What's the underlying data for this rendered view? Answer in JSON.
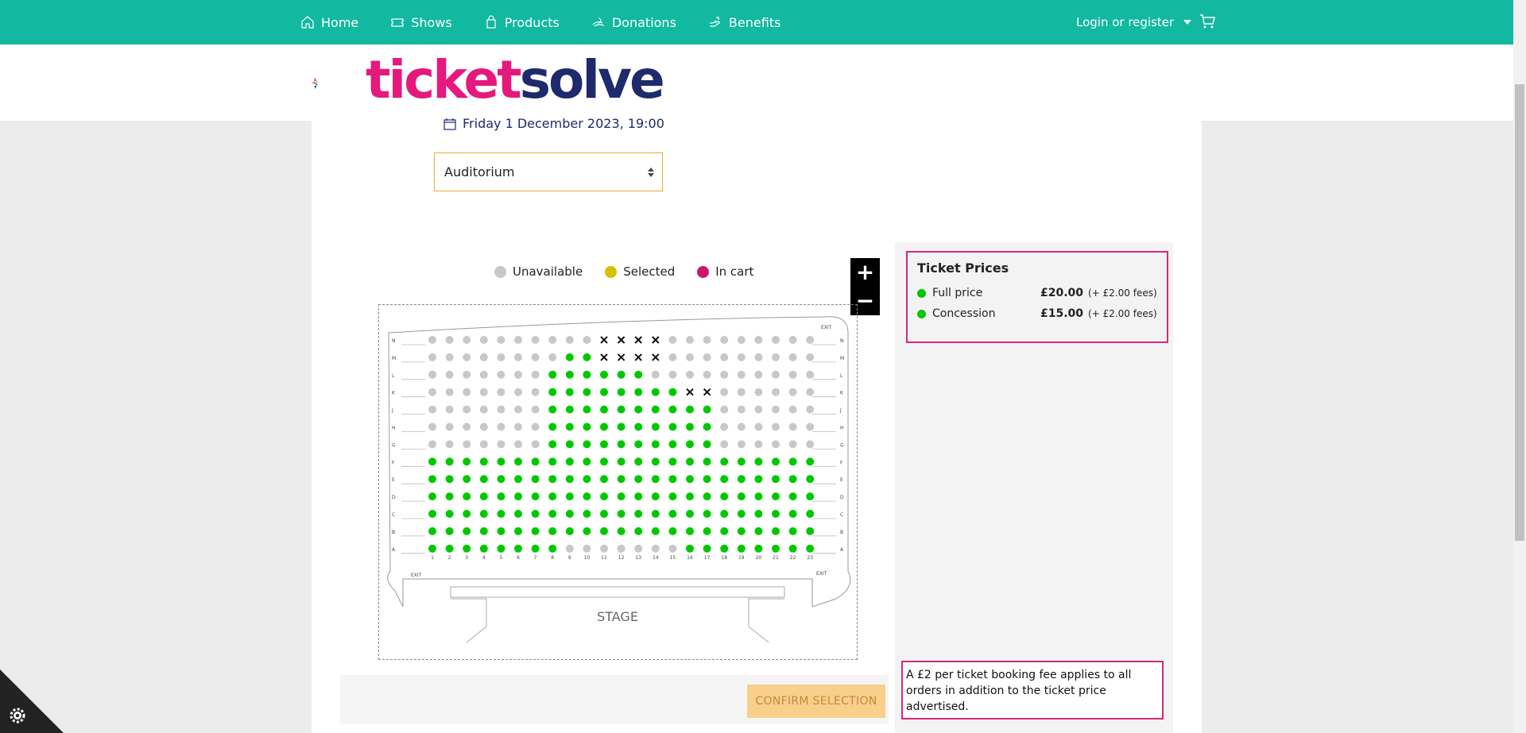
{
  "nav": {
    "items": [
      {
        "label": "Home",
        "icon": "home-icon"
      },
      {
        "label": "Shows",
        "icon": "ticket-icon"
      },
      {
        "label": "Products",
        "icon": "bag-icon"
      },
      {
        "label": "Donations",
        "icon": "donate-icon"
      },
      {
        "label": "Benefits",
        "icon": "hand-icon"
      }
    ],
    "login_label": "Login or register"
  },
  "logo": {
    "part1": "ticket",
    "part2": "solve"
  },
  "event": {
    "datetime": "Friday 1 December 2023, 19:00"
  },
  "venue_select": {
    "value": "Auditorium"
  },
  "legend": {
    "unavailable": "Unavailable",
    "selected": "Selected",
    "in_cart": "In cart"
  },
  "zoom": {
    "in": "+",
    "out": "−"
  },
  "seatmap": {
    "rows": [
      "N",
      "M",
      "L",
      "K",
      "J",
      "H",
      "G",
      "F",
      "E",
      "D",
      "C",
      "B",
      "A"
    ],
    "columns": [
      "1",
      "2",
      "3",
      "4",
      "5",
      "6",
      "7",
      "8",
      "9",
      "10",
      "11",
      "12",
      "13",
      "14",
      "15",
      "16",
      "17",
      "18",
      "19",
      "20",
      "21",
      "22",
      "23"
    ],
    "exit_label": "EXIT",
    "stage_label": "STAGE",
    "legend": "X = sold seat, G = available, U = unavailable",
    "layout": [
      "UUUUUUUUUUXXXXUUUUUUUUU",
      "UUUUUUUUGGXXXXUUUUUUUUU",
      "UUUUUUUGGGGGGUUUUUUUUUU",
      "UUUUUUUGGGGGGGGXXUUUUUU",
      "UUUUUUUGGGGGGGGGGUUUUUU",
      "UUUUUUUGGGGGGGGGGUUUUUU",
      "UUUUUUUGGGGGGGGGGUUUUUU",
      "GGGGGGGGGGGGGGGGGGGGGGG",
      "GGGGGGGGGGGGGGGGGGGGGGG",
      "GGGGGGGGGGGGGGGGGGGGGGG",
      "GGGGGGGGGGGGGGGGGGGGGGG",
      "GGGGGGGGGGGGGGGGGGGGGGG",
      "GGGGGGGGUUUUUUUGGGGGGGG"
    ]
  },
  "prices": {
    "title": "Ticket Prices",
    "rows": [
      {
        "name": "Full price",
        "amount": "£20.00",
        "fee": "(+ £2.00 fees)"
      },
      {
        "name": "Concession",
        "amount": "£15.00",
        "fee": "(+ £2.00 fees)"
      }
    ]
  },
  "confirm_label": "CONFIRM SELECTION",
  "fee_note": "A £2 per ticket booking fee applies to all orders in addition to the ticket price advertised.",
  "colors": {
    "brand": "#12b8a0",
    "available": "#00c800",
    "unavailable": "#c8c8c8",
    "selected": "#d6c000",
    "in_cart": "#c8186b",
    "highlight": "#d4287e"
  }
}
